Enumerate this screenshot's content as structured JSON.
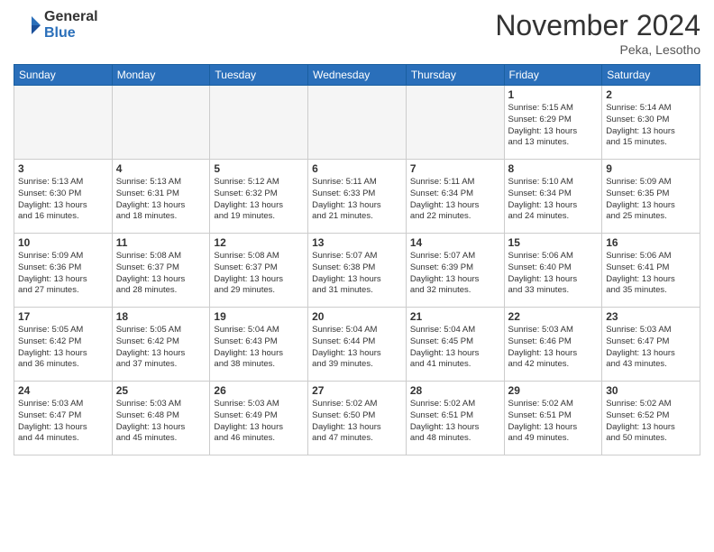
{
  "header": {
    "logo_general": "General",
    "logo_blue": "Blue",
    "month_title": "November 2024",
    "location": "Peka, Lesotho"
  },
  "weekdays": [
    "Sunday",
    "Monday",
    "Tuesday",
    "Wednesday",
    "Thursday",
    "Friday",
    "Saturday"
  ],
  "weeks": [
    [
      {
        "day": "",
        "info": ""
      },
      {
        "day": "",
        "info": ""
      },
      {
        "day": "",
        "info": ""
      },
      {
        "day": "",
        "info": ""
      },
      {
        "day": "",
        "info": ""
      },
      {
        "day": "1",
        "info": "Sunrise: 5:15 AM\nSunset: 6:29 PM\nDaylight: 13 hours\nand 13 minutes."
      },
      {
        "day": "2",
        "info": "Sunrise: 5:14 AM\nSunset: 6:30 PM\nDaylight: 13 hours\nand 15 minutes."
      }
    ],
    [
      {
        "day": "3",
        "info": "Sunrise: 5:13 AM\nSunset: 6:30 PM\nDaylight: 13 hours\nand 16 minutes."
      },
      {
        "day": "4",
        "info": "Sunrise: 5:13 AM\nSunset: 6:31 PM\nDaylight: 13 hours\nand 18 minutes."
      },
      {
        "day": "5",
        "info": "Sunrise: 5:12 AM\nSunset: 6:32 PM\nDaylight: 13 hours\nand 19 minutes."
      },
      {
        "day": "6",
        "info": "Sunrise: 5:11 AM\nSunset: 6:33 PM\nDaylight: 13 hours\nand 21 minutes."
      },
      {
        "day": "7",
        "info": "Sunrise: 5:11 AM\nSunset: 6:34 PM\nDaylight: 13 hours\nand 22 minutes."
      },
      {
        "day": "8",
        "info": "Sunrise: 5:10 AM\nSunset: 6:34 PM\nDaylight: 13 hours\nand 24 minutes."
      },
      {
        "day": "9",
        "info": "Sunrise: 5:09 AM\nSunset: 6:35 PM\nDaylight: 13 hours\nand 25 minutes."
      }
    ],
    [
      {
        "day": "10",
        "info": "Sunrise: 5:09 AM\nSunset: 6:36 PM\nDaylight: 13 hours\nand 27 minutes."
      },
      {
        "day": "11",
        "info": "Sunrise: 5:08 AM\nSunset: 6:37 PM\nDaylight: 13 hours\nand 28 minutes."
      },
      {
        "day": "12",
        "info": "Sunrise: 5:08 AM\nSunset: 6:37 PM\nDaylight: 13 hours\nand 29 minutes."
      },
      {
        "day": "13",
        "info": "Sunrise: 5:07 AM\nSunset: 6:38 PM\nDaylight: 13 hours\nand 31 minutes."
      },
      {
        "day": "14",
        "info": "Sunrise: 5:07 AM\nSunset: 6:39 PM\nDaylight: 13 hours\nand 32 minutes."
      },
      {
        "day": "15",
        "info": "Sunrise: 5:06 AM\nSunset: 6:40 PM\nDaylight: 13 hours\nand 33 minutes."
      },
      {
        "day": "16",
        "info": "Sunrise: 5:06 AM\nSunset: 6:41 PM\nDaylight: 13 hours\nand 35 minutes."
      }
    ],
    [
      {
        "day": "17",
        "info": "Sunrise: 5:05 AM\nSunset: 6:42 PM\nDaylight: 13 hours\nand 36 minutes."
      },
      {
        "day": "18",
        "info": "Sunrise: 5:05 AM\nSunset: 6:42 PM\nDaylight: 13 hours\nand 37 minutes."
      },
      {
        "day": "19",
        "info": "Sunrise: 5:04 AM\nSunset: 6:43 PM\nDaylight: 13 hours\nand 38 minutes."
      },
      {
        "day": "20",
        "info": "Sunrise: 5:04 AM\nSunset: 6:44 PM\nDaylight: 13 hours\nand 39 minutes."
      },
      {
        "day": "21",
        "info": "Sunrise: 5:04 AM\nSunset: 6:45 PM\nDaylight: 13 hours\nand 41 minutes."
      },
      {
        "day": "22",
        "info": "Sunrise: 5:03 AM\nSunset: 6:46 PM\nDaylight: 13 hours\nand 42 minutes."
      },
      {
        "day": "23",
        "info": "Sunrise: 5:03 AM\nSunset: 6:47 PM\nDaylight: 13 hours\nand 43 minutes."
      }
    ],
    [
      {
        "day": "24",
        "info": "Sunrise: 5:03 AM\nSunset: 6:47 PM\nDaylight: 13 hours\nand 44 minutes."
      },
      {
        "day": "25",
        "info": "Sunrise: 5:03 AM\nSunset: 6:48 PM\nDaylight: 13 hours\nand 45 minutes."
      },
      {
        "day": "26",
        "info": "Sunrise: 5:03 AM\nSunset: 6:49 PM\nDaylight: 13 hours\nand 46 minutes."
      },
      {
        "day": "27",
        "info": "Sunrise: 5:02 AM\nSunset: 6:50 PM\nDaylight: 13 hours\nand 47 minutes."
      },
      {
        "day": "28",
        "info": "Sunrise: 5:02 AM\nSunset: 6:51 PM\nDaylight: 13 hours\nand 48 minutes."
      },
      {
        "day": "29",
        "info": "Sunrise: 5:02 AM\nSunset: 6:51 PM\nDaylight: 13 hours\nand 49 minutes."
      },
      {
        "day": "30",
        "info": "Sunrise: 5:02 AM\nSunset: 6:52 PM\nDaylight: 13 hours\nand 50 minutes."
      }
    ]
  ]
}
